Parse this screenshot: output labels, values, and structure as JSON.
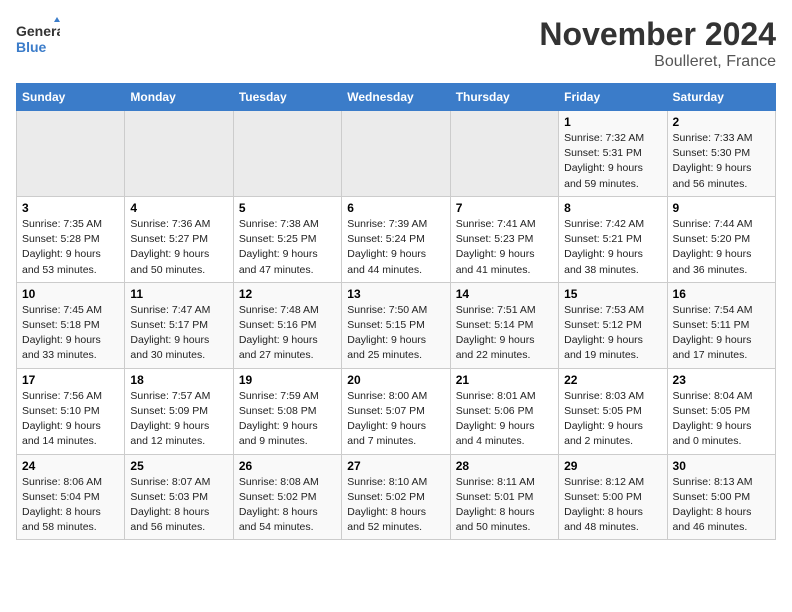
{
  "logo": {
    "line1": "General",
    "line2": "Blue"
  },
  "title": "November 2024",
  "subtitle": "Boulleret, France",
  "weekdays": [
    "Sunday",
    "Monday",
    "Tuesday",
    "Wednesday",
    "Thursday",
    "Friday",
    "Saturday"
  ],
  "weeks": [
    [
      {
        "day": "",
        "sunrise": "",
        "sunset": "",
        "daylight": ""
      },
      {
        "day": "",
        "sunrise": "",
        "sunset": "",
        "daylight": ""
      },
      {
        "day": "",
        "sunrise": "",
        "sunset": "",
        "daylight": ""
      },
      {
        "day": "",
        "sunrise": "",
        "sunset": "",
        "daylight": ""
      },
      {
        "day": "",
        "sunrise": "",
        "sunset": "",
        "daylight": ""
      },
      {
        "day": "1",
        "sunrise": "Sunrise: 7:32 AM",
        "sunset": "Sunset: 5:31 PM",
        "daylight": "Daylight: 9 hours and 59 minutes."
      },
      {
        "day": "2",
        "sunrise": "Sunrise: 7:33 AM",
        "sunset": "Sunset: 5:30 PM",
        "daylight": "Daylight: 9 hours and 56 minutes."
      }
    ],
    [
      {
        "day": "3",
        "sunrise": "Sunrise: 7:35 AM",
        "sunset": "Sunset: 5:28 PM",
        "daylight": "Daylight: 9 hours and 53 minutes."
      },
      {
        "day": "4",
        "sunrise": "Sunrise: 7:36 AM",
        "sunset": "Sunset: 5:27 PM",
        "daylight": "Daylight: 9 hours and 50 minutes."
      },
      {
        "day": "5",
        "sunrise": "Sunrise: 7:38 AM",
        "sunset": "Sunset: 5:25 PM",
        "daylight": "Daylight: 9 hours and 47 minutes."
      },
      {
        "day": "6",
        "sunrise": "Sunrise: 7:39 AM",
        "sunset": "Sunset: 5:24 PM",
        "daylight": "Daylight: 9 hours and 44 minutes."
      },
      {
        "day": "7",
        "sunrise": "Sunrise: 7:41 AM",
        "sunset": "Sunset: 5:23 PM",
        "daylight": "Daylight: 9 hours and 41 minutes."
      },
      {
        "day": "8",
        "sunrise": "Sunrise: 7:42 AM",
        "sunset": "Sunset: 5:21 PM",
        "daylight": "Daylight: 9 hours and 38 minutes."
      },
      {
        "day": "9",
        "sunrise": "Sunrise: 7:44 AM",
        "sunset": "Sunset: 5:20 PM",
        "daylight": "Daylight: 9 hours and 36 minutes."
      }
    ],
    [
      {
        "day": "10",
        "sunrise": "Sunrise: 7:45 AM",
        "sunset": "Sunset: 5:18 PM",
        "daylight": "Daylight: 9 hours and 33 minutes."
      },
      {
        "day": "11",
        "sunrise": "Sunrise: 7:47 AM",
        "sunset": "Sunset: 5:17 PM",
        "daylight": "Daylight: 9 hours and 30 minutes."
      },
      {
        "day": "12",
        "sunrise": "Sunrise: 7:48 AM",
        "sunset": "Sunset: 5:16 PM",
        "daylight": "Daylight: 9 hours and 27 minutes."
      },
      {
        "day": "13",
        "sunrise": "Sunrise: 7:50 AM",
        "sunset": "Sunset: 5:15 PM",
        "daylight": "Daylight: 9 hours and 25 minutes."
      },
      {
        "day": "14",
        "sunrise": "Sunrise: 7:51 AM",
        "sunset": "Sunset: 5:14 PM",
        "daylight": "Daylight: 9 hours and 22 minutes."
      },
      {
        "day": "15",
        "sunrise": "Sunrise: 7:53 AM",
        "sunset": "Sunset: 5:12 PM",
        "daylight": "Daylight: 9 hours and 19 minutes."
      },
      {
        "day": "16",
        "sunrise": "Sunrise: 7:54 AM",
        "sunset": "Sunset: 5:11 PM",
        "daylight": "Daylight: 9 hours and 17 minutes."
      }
    ],
    [
      {
        "day": "17",
        "sunrise": "Sunrise: 7:56 AM",
        "sunset": "Sunset: 5:10 PM",
        "daylight": "Daylight: 9 hours and 14 minutes."
      },
      {
        "day": "18",
        "sunrise": "Sunrise: 7:57 AM",
        "sunset": "Sunset: 5:09 PM",
        "daylight": "Daylight: 9 hours and 12 minutes."
      },
      {
        "day": "19",
        "sunrise": "Sunrise: 7:59 AM",
        "sunset": "Sunset: 5:08 PM",
        "daylight": "Daylight: 9 hours and 9 minutes."
      },
      {
        "day": "20",
        "sunrise": "Sunrise: 8:00 AM",
        "sunset": "Sunset: 5:07 PM",
        "daylight": "Daylight: 9 hours and 7 minutes."
      },
      {
        "day": "21",
        "sunrise": "Sunrise: 8:01 AM",
        "sunset": "Sunset: 5:06 PM",
        "daylight": "Daylight: 9 hours and 4 minutes."
      },
      {
        "day": "22",
        "sunrise": "Sunrise: 8:03 AM",
        "sunset": "Sunset: 5:05 PM",
        "daylight": "Daylight: 9 hours and 2 minutes."
      },
      {
        "day": "23",
        "sunrise": "Sunrise: 8:04 AM",
        "sunset": "Sunset: 5:05 PM",
        "daylight": "Daylight: 9 hours and 0 minutes."
      }
    ],
    [
      {
        "day": "24",
        "sunrise": "Sunrise: 8:06 AM",
        "sunset": "Sunset: 5:04 PM",
        "daylight": "Daylight: 8 hours and 58 minutes."
      },
      {
        "day": "25",
        "sunrise": "Sunrise: 8:07 AM",
        "sunset": "Sunset: 5:03 PM",
        "daylight": "Daylight: 8 hours and 56 minutes."
      },
      {
        "day": "26",
        "sunrise": "Sunrise: 8:08 AM",
        "sunset": "Sunset: 5:02 PM",
        "daylight": "Daylight: 8 hours and 54 minutes."
      },
      {
        "day": "27",
        "sunrise": "Sunrise: 8:10 AM",
        "sunset": "Sunset: 5:02 PM",
        "daylight": "Daylight: 8 hours and 52 minutes."
      },
      {
        "day": "28",
        "sunrise": "Sunrise: 8:11 AM",
        "sunset": "Sunset: 5:01 PM",
        "daylight": "Daylight: 8 hours and 50 minutes."
      },
      {
        "day": "29",
        "sunrise": "Sunrise: 8:12 AM",
        "sunset": "Sunset: 5:00 PM",
        "daylight": "Daylight: 8 hours and 48 minutes."
      },
      {
        "day": "30",
        "sunrise": "Sunrise: 8:13 AM",
        "sunset": "Sunset: 5:00 PM",
        "daylight": "Daylight: 8 hours and 46 minutes."
      }
    ]
  ]
}
